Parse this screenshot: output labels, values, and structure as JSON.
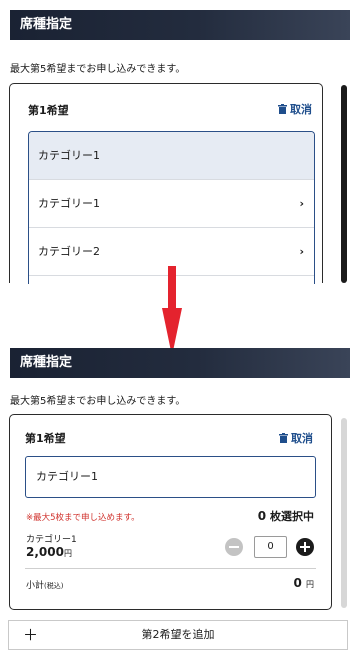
{
  "top_panel": {
    "section_title": "席種指定",
    "notice": "最大第5希望までお申し込みできます。",
    "preference_title": "第1希望",
    "cancel_label": "取消",
    "dropdown_selected": "カテゴリー1",
    "dropdown_options": [
      "カテゴリー1",
      "カテゴリー2"
    ],
    "chevron": "›"
  },
  "bottom_panel": {
    "section_title": "席種指定",
    "notice": "最大第5希望までお申し込みできます。",
    "preference_title": "第1希望",
    "cancel_label": "取消",
    "selected_category": "カテゴリー1",
    "limit_note": "※最大5枚まで申し込めます。",
    "selected_count": "0",
    "selected_count_suffix": "枚選択中",
    "category_label": "カテゴリー1",
    "price": "2,000",
    "price_unit": "円",
    "quantity": "0",
    "subtotal_label": "小計",
    "subtotal_tax": "(税込)",
    "subtotal_value": "0",
    "subtotal_unit": "円",
    "add_button_label": "第2希望を追加"
  },
  "colors": {
    "header_dark": "#1a2233",
    "accent_blue": "#1f4e8c",
    "border_blue": "#2b4f87",
    "error_red": "#d0322d",
    "arrow_red": "#e4232e"
  },
  "icons": {
    "cancel": "trash-icon",
    "transition": "down-arrow-icon",
    "decrement": "minus-circle-icon",
    "increment": "plus-circle-icon"
  }
}
